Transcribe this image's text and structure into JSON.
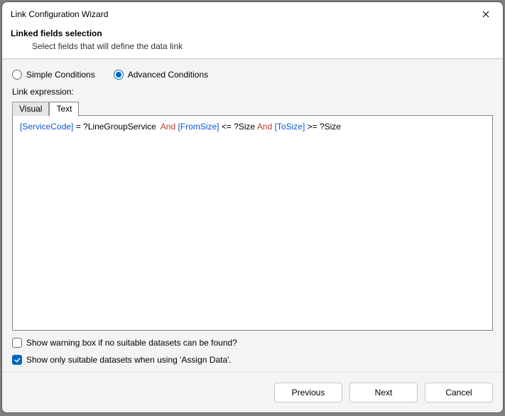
{
  "window": {
    "title": "Link Configuration Wizard"
  },
  "header": {
    "heading": "Linked fields selection",
    "subheading": "Select fields that will define the data link"
  },
  "conditions": {
    "simple_label": "Simple Conditions",
    "advanced_label": "Advanced Conditions",
    "selected": "advanced"
  },
  "expression": {
    "label": "Link expression:",
    "tabs": {
      "visual": "Visual",
      "text": "Text",
      "active": "text"
    },
    "tokens": [
      {
        "t": "field",
        "v": "[ServiceCode]"
      },
      {
        "t": "plain",
        "v": " = ?LineGroupService  "
      },
      {
        "t": "kw",
        "v": "And"
      },
      {
        "t": "plain",
        "v": " "
      },
      {
        "t": "field",
        "v": "[FromSize]"
      },
      {
        "t": "plain",
        "v": " <= ?Size "
      },
      {
        "t": "kw",
        "v": "And"
      },
      {
        "t": "plain",
        "v": " "
      },
      {
        "t": "field",
        "v": "[ToSize]"
      },
      {
        "t": "plain",
        "v": " >= ?Size"
      }
    ]
  },
  "options": {
    "warn_missing": {
      "label": "Show warning box if no suitable datasets can be found?",
      "checked": false
    },
    "only_suitable": {
      "label": "Show only suitable datasets when using 'Assign Data'.",
      "checked": true
    }
  },
  "footer": {
    "previous": "Previous",
    "next": "Next",
    "cancel": "Cancel"
  }
}
